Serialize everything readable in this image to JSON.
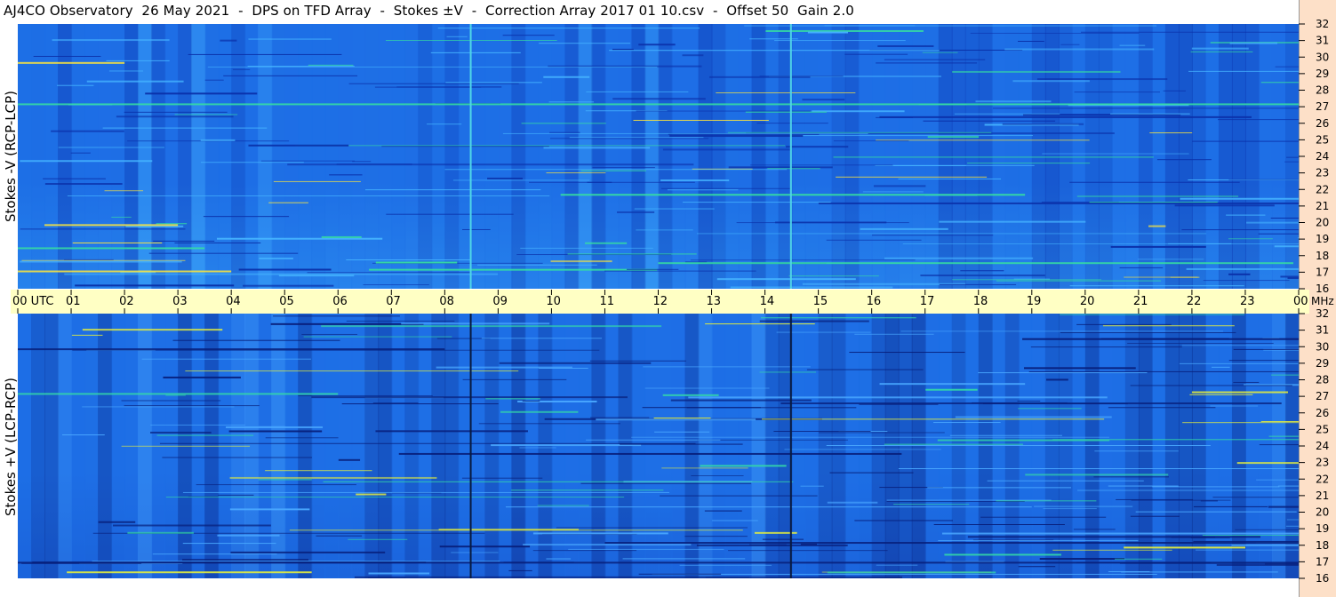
{
  "title": "AJ4CO Observatory  26 May 2021  -  DPS on TFD Array  -  Stokes ±V  -  Correction Array 2017 01 10.csv  -  Offset 50  Gain 2.0",
  "chart_data": [
    {
      "type": "heatmap",
      "panel": "top",
      "ylabel": "Stokes -V (RCP-LCP)",
      "x_ticks": [
        "00 UTC",
        "01",
        "02",
        "03",
        "04",
        "05",
        "06",
        "07",
        "08",
        "09",
        "10",
        "11",
        "12",
        "13",
        "14",
        "15",
        "16",
        "17",
        "18",
        "19",
        "20",
        "21",
        "22",
        "23",
        "00"
      ],
      "x_unit": "UTC",
      "y_ticks": [
        "16",
        "17",
        "18",
        "19",
        "20",
        "21",
        "22",
        "23",
        "24",
        "25",
        "26",
        "27",
        "28",
        "29",
        "30",
        "31",
        "32"
      ],
      "ylim": [
        16,
        32
      ],
      "xlim": [
        0,
        24
      ],
      "vertical_markers_utc": [
        8.47,
        14.47
      ],
      "marker_color": "#4fd6e8",
      "colors": {
        "base": "#1e6fe6",
        "dark": "#0a2fa8",
        "light": "#46b4ff",
        "hot": "#ffe63a",
        "warm": "#36e0a0"
      }
    },
    {
      "type": "heatmap",
      "panel": "bottom",
      "ylabel": "Stokes +V (LCP-RCP)",
      "x_ticks": [
        "00 UTC",
        "01",
        "02",
        "03",
        "04",
        "05",
        "06",
        "07",
        "08",
        "09",
        "10",
        "11",
        "12",
        "13",
        "14",
        "15",
        "16",
        "17",
        "18",
        "19",
        "20",
        "21",
        "22",
        "23",
        "00"
      ],
      "x_unit": "UTC",
      "y_ticks": [
        "16",
        "17",
        "18",
        "19",
        "20",
        "21",
        "22",
        "23",
        "24",
        "25",
        "26",
        "27",
        "28",
        "29",
        "30",
        "31",
        "32"
      ],
      "y_unit": "MHz",
      "ylim": [
        16,
        32
      ],
      "xlim": [
        0,
        24
      ],
      "vertical_markers_utc": [
        8.47,
        14.47
      ],
      "marker_color": "#081a40",
      "colors": {
        "base": "#1e6fe6",
        "dark": "#071e7a",
        "light": "#4aa8ff",
        "hot": "#e8f03a",
        "warm": "#34d8a8"
      }
    }
  ]
}
